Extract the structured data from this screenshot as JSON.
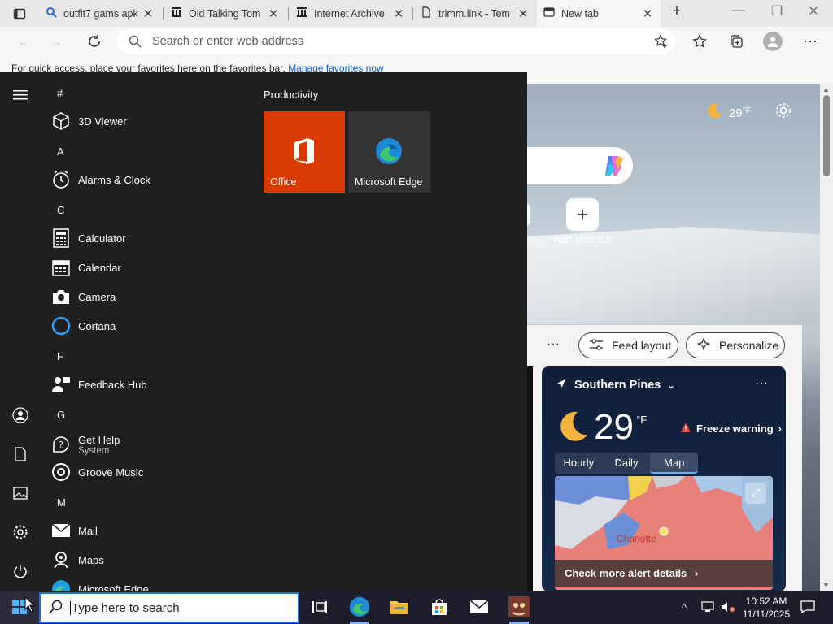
{
  "tabs": [
    {
      "title": "outfit7 gams apk",
      "icon": "search-icon"
    },
    {
      "title": "Old Talking Tom",
      "icon": "archive-icon"
    },
    {
      "title": "Internet Archive",
      "icon": "archive-icon"
    },
    {
      "title": "trimm.link - Tem",
      "icon": "page-icon"
    },
    {
      "title": "New tab",
      "icon": "newtab-icon"
    }
  ],
  "address_bar": {
    "placeholder": "Search or enter web address"
  },
  "favorites_bar": {
    "text": "For quick access, place your favorites here on the favorites bar.",
    "link": "Manage favorites now"
  },
  "new_tab": {
    "header_weather_temp": "29",
    "header_weather_unit": "°F",
    "add_shortcut_label": "Add shortcut",
    "feed_layout_label": "Feed layout",
    "personalize_label": "Personalize",
    "weather_card": {
      "location": "Southern Pines",
      "temperature": "29",
      "unit": "°F",
      "alert": "Freeze warning",
      "tabs": [
        "Hourly",
        "Daily",
        "Map"
      ],
      "active_tab": "Map",
      "map_city": "Charlotte",
      "footer": "Check more alert details"
    }
  },
  "start_menu": {
    "sections": [
      {
        "letter": "#",
        "apps": [
          {
            "name": "3D Viewer",
            "icon": "cube-icon"
          }
        ]
      },
      {
        "letter": "A",
        "apps": [
          {
            "name": "Alarms & Clock",
            "icon": "clock-icon"
          }
        ]
      },
      {
        "letter": "C",
        "apps": [
          {
            "name": "Calculator",
            "icon": "calculator-icon"
          },
          {
            "name": "Calendar",
            "icon": "calendar-icon"
          },
          {
            "name": "Camera",
            "icon": "camera-icon"
          },
          {
            "name": "Cortana",
            "icon": "cortana-icon"
          }
        ]
      },
      {
        "letter": "F",
        "apps": [
          {
            "name": "Feedback Hub",
            "icon": "feedback-icon"
          }
        ]
      },
      {
        "letter": "G",
        "apps": [
          {
            "name": "Get Help",
            "sub": "System",
            "icon": "help-icon"
          },
          {
            "name": "Groove Music",
            "icon": "music-icon"
          }
        ]
      },
      {
        "letter": "M",
        "apps": [
          {
            "name": "Mail",
            "icon": "mail-icon"
          },
          {
            "name": "Maps",
            "icon": "maps-icon"
          },
          {
            "name": "Microsoft Edge",
            "icon": "edge-icon"
          }
        ]
      }
    ],
    "tiles_header": "Productivity",
    "tiles": [
      {
        "name": "Office",
        "color": "#d83b01"
      },
      {
        "name": "Microsoft Edge",
        "color": "#333333"
      }
    ]
  },
  "taskbar": {
    "search_placeholder": "Type here to search",
    "time": "10:52 AM",
    "date": "11/11/2025"
  },
  "colors": {
    "accent": "#0078d4",
    "office": "#d83b01",
    "tile_dark": "#333333"
  }
}
